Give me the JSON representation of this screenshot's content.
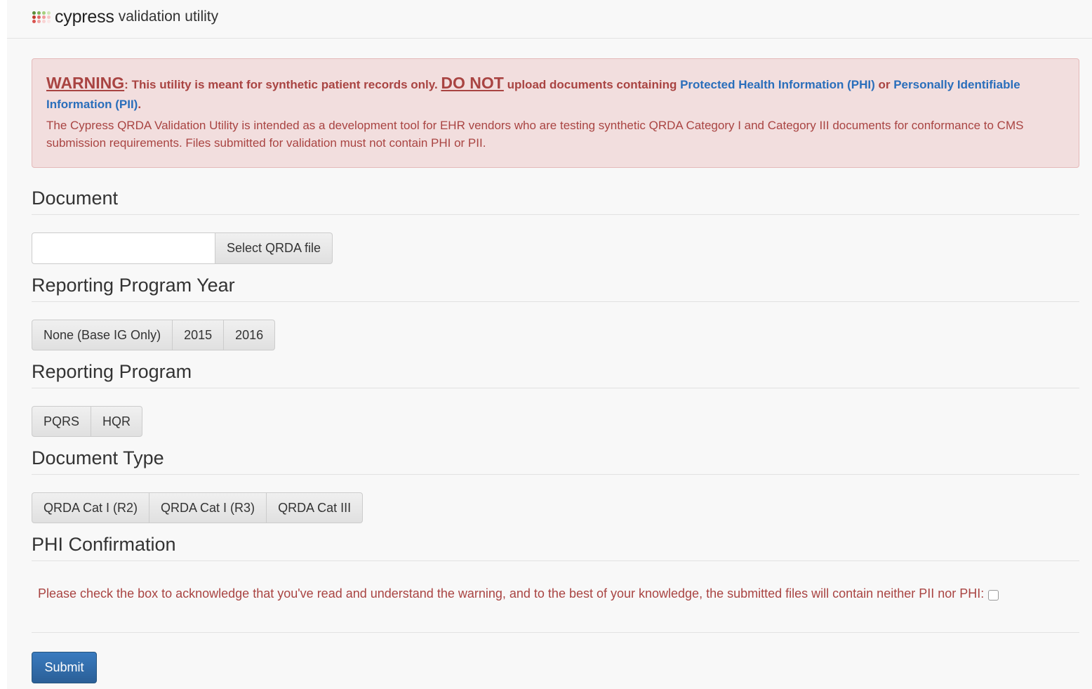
{
  "brand": {
    "name": "cypress",
    "suffix": "validation utility",
    "logo_colors": [
      "#5b8e3b",
      "#7fb35a",
      "#a6d17f",
      "#cfe6b8",
      "#c0392b",
      "#e06666",
      "#f19999",
      "#f7c6c6",
      "#d9534f",
      "#f0a3a3",
      "#f9d3d3",
      "#fbe6e6"
    ]
  },
  "warning": {
    "label": "WARNING",
    "colon": ":",
    "text1": " This utility is meant for synthetic patient records only. ",
    "do_not": "DO NOT",
    "text2": " upload documents containing ",
    "link_phi": "Protected Health Information (PHI)",
    "text3": " or ",
    "link_pii": "Personally Identifiable Information (PII)",
    "text4": ".",
    "body": "The Cypress QRDA Validation Utility is intended as a development tool for EHR vendors who are testing synthetic QRDA Category I and Category III documents for conformance to CMS submission requirements. Files submitted for validation must not contain PHI or PII."
  },
  "document": {
    "title": "Document",
    "file_value": "",
    "select_button": "Select QRDA file"
  },
  "program_year": {
    "title": "Reporting Program Year",
    "options": [
      "None (Base IG Only)",
      "2015",
      "2016"
    ]
  },
  "program": {
    "title": "Reporting Program",
    "options": [
      "PQRS",
      "HQR"
    ]
  },
  "doc_type": {
    "title": "Document Type",
    "options": [
      "QRDA Cat I (R2)",
      "QRDA Cat I (R3)",
      "QRDA Cat III"
    ]
  },
  "phi": {
    "title": "PHI Confirmation",
    "text": "Please check the box to acknowledge that you've read and understand the warning, and to the best of your knowledge, the submitted files will contain neither PII nor PHI:",
    "checked": false
  },
  "submit_label": "Submit"
}
